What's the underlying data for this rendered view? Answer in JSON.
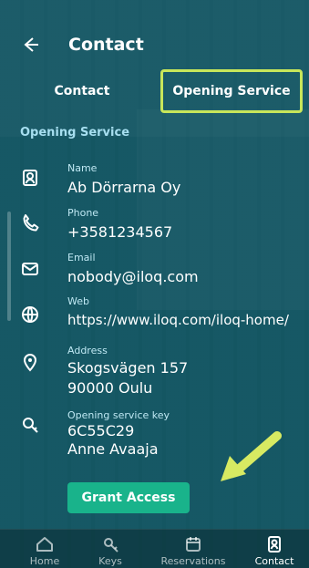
{
  "header": {
    "title": "Contact"
  },
  "tabs": [
    {
      "label": "Contact"
    },
    {
      "label": "Opening Service"
    }
  ],
  "section": {
    "title": "Opening Service"
  },
  "fields": {
    "name": {
      "label": "Name",
      "value": "Ab Dörrarna Oy"
    },
    "phone": {
      "label": "Phone",
      "value": "+3581234567"
    },
    "email": {
      "label": "Email",
      "value": "nobody@iloq.com"
    },
    "web": {
      "label": "Web",
      "value": "https://www.iloq.com/iloq-home/"
    },
    "address": {
      "label": "Address",
      "line1": "Skogsvägen 157",
      "line2": "90000 Oulu"
    },
    "opening_key": {
      "label": "Opening service key",
      "line1": "6C55C29",
      "line2": "Anne Avaaja"
    }
  },
  "actions": {
    "grant": "Grant Access"
  },
  "bottom_nav": [
    {
      "label": "Home",
      "icon": "home-icon"
    },
    {
      "label": "Keys",
      "icon": "key-icon"
    },
    {
      "label": "Reservations",
      "icon": "calendar-icon"
    },
    {
      "label": "Contact",
      "icon": "contact-icon"
    }
  ],
  "colors": {
    "accent": "#19b38b",
    "highlight": "#c8e65a",
    "section_title": "#a7dff0"
  }
}
